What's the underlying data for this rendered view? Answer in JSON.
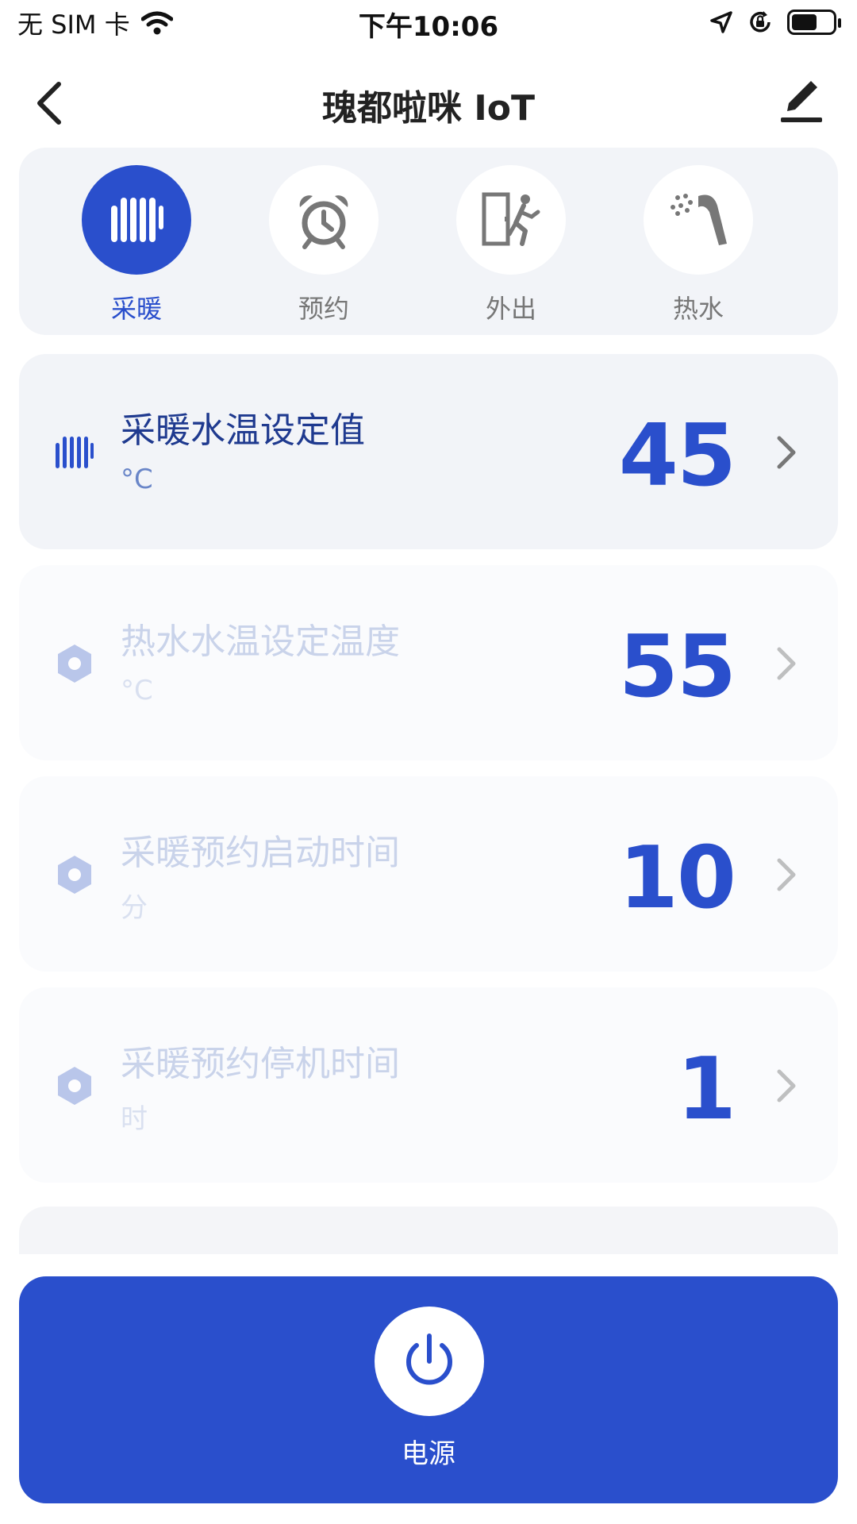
{
  "status_bar": {
    "carrier": "无 SIM 卡",
    "time": "下午10:06"
  },
  "nav": {
    "title": "瑰都啦咪 IoT"
  },
  "modes": [
    {
      "label": "采暖",
      "icon": "radiator-icon",
      "active": true
    },
    {
      "label": "预约",
      "icon": "alarm-clock-icon",
      "active": false
    },
    {
      "label": "外出",
      "icon": "exit-door-icon",
      "active": false
    },
    {
      "label": "热水",
      "icon": "shower-icon",
      "active": false
    }
  ],
  "settings": [
    {
      "title": "采暖水温设定值",
      "unit": "°C",
      "value": "45",
      "icon": "radiator-icon",
      "enabled": true
    },
    {
      "title": "热水水温设定温度",
      "unit": "°C",
      "value": "55",
      "icon": "hex-nut-icon",
      "enabled": false
    },
    {
      "title": "采暖预约启动时间",
      "unit": "分",
      "value": "10",
      "icon": "hex-nut-icon",
      "enabled": false
    },
    {
      "title": "采暖预约停机时间",
      "unit": "时",
      "value": "1",
      "icon": "hex-nut-icon",
      "enabled": false
    }
  ],
  "power": {
    "label": "电源",
    "icon": "power-icon"
  },
  "colors": {
    "accent": "#2a4fcc",
    "card_bg": "#f2f4f8"
  }
}
